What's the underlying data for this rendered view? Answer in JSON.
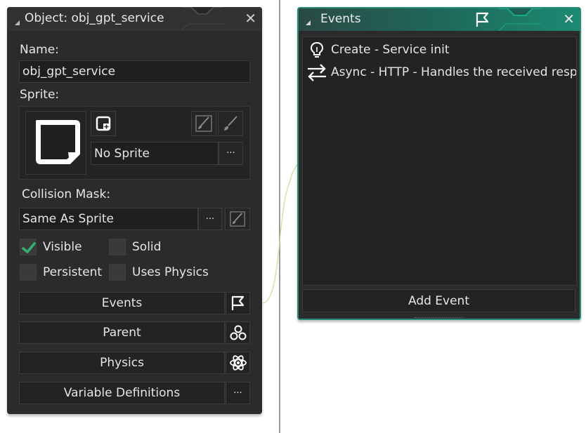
{
  "object_panel": {
    "title": "Object: obj_gpt_service",
    "name_label": "Name:",
    "name_value": "obj_gpt_service",
    "sprite_label": "Sprite:",
    "sprite_value": "No Sprite",
    "browse_label": "···",
    "collision_label": "Collision Mask:",
    "collision_value": "Same As Sprite",
    "collision_browse_label": "···",
    "checkboxes": {
      "visible": {
        "label": "Visible",
        "checked": true
      },
      "solid": {
        "label": "Solid",
        "checked": false
      },
      "persistent": {
        "label": "Persistent",
        "checked": false
      },
      "uses_physics": {
        "label": "Uses Physics",
        "checked": false
      }
    },
    "buttons": {
      "events": "Events",
      "parent": "Parent",
      "physics": "Physics",
      "variable_definitions": "Variable Definitions",
      "variable_definitions_more": "···"
    }
  },
  "events_panel": {
    "title": "Events",
    "events": [
      {
        "label": "Create - Service init",
        "icon": "lightbulb-icon"
      },
      {
        "label": "Async - HTTP - Handles the received response",
        "icon": "arrows-exchange-icon"
      }
    ],
    "add_event_label": "Add Event"
  },
  "colors": {
    "panel_bg": "#2b2b2b",
    "field_bg": "#1f1f1f",
    "accent_teal": "#2b8c78",
    "check_green": "#2fb36e",
    "connector": "#c8e39a"
  }
}
